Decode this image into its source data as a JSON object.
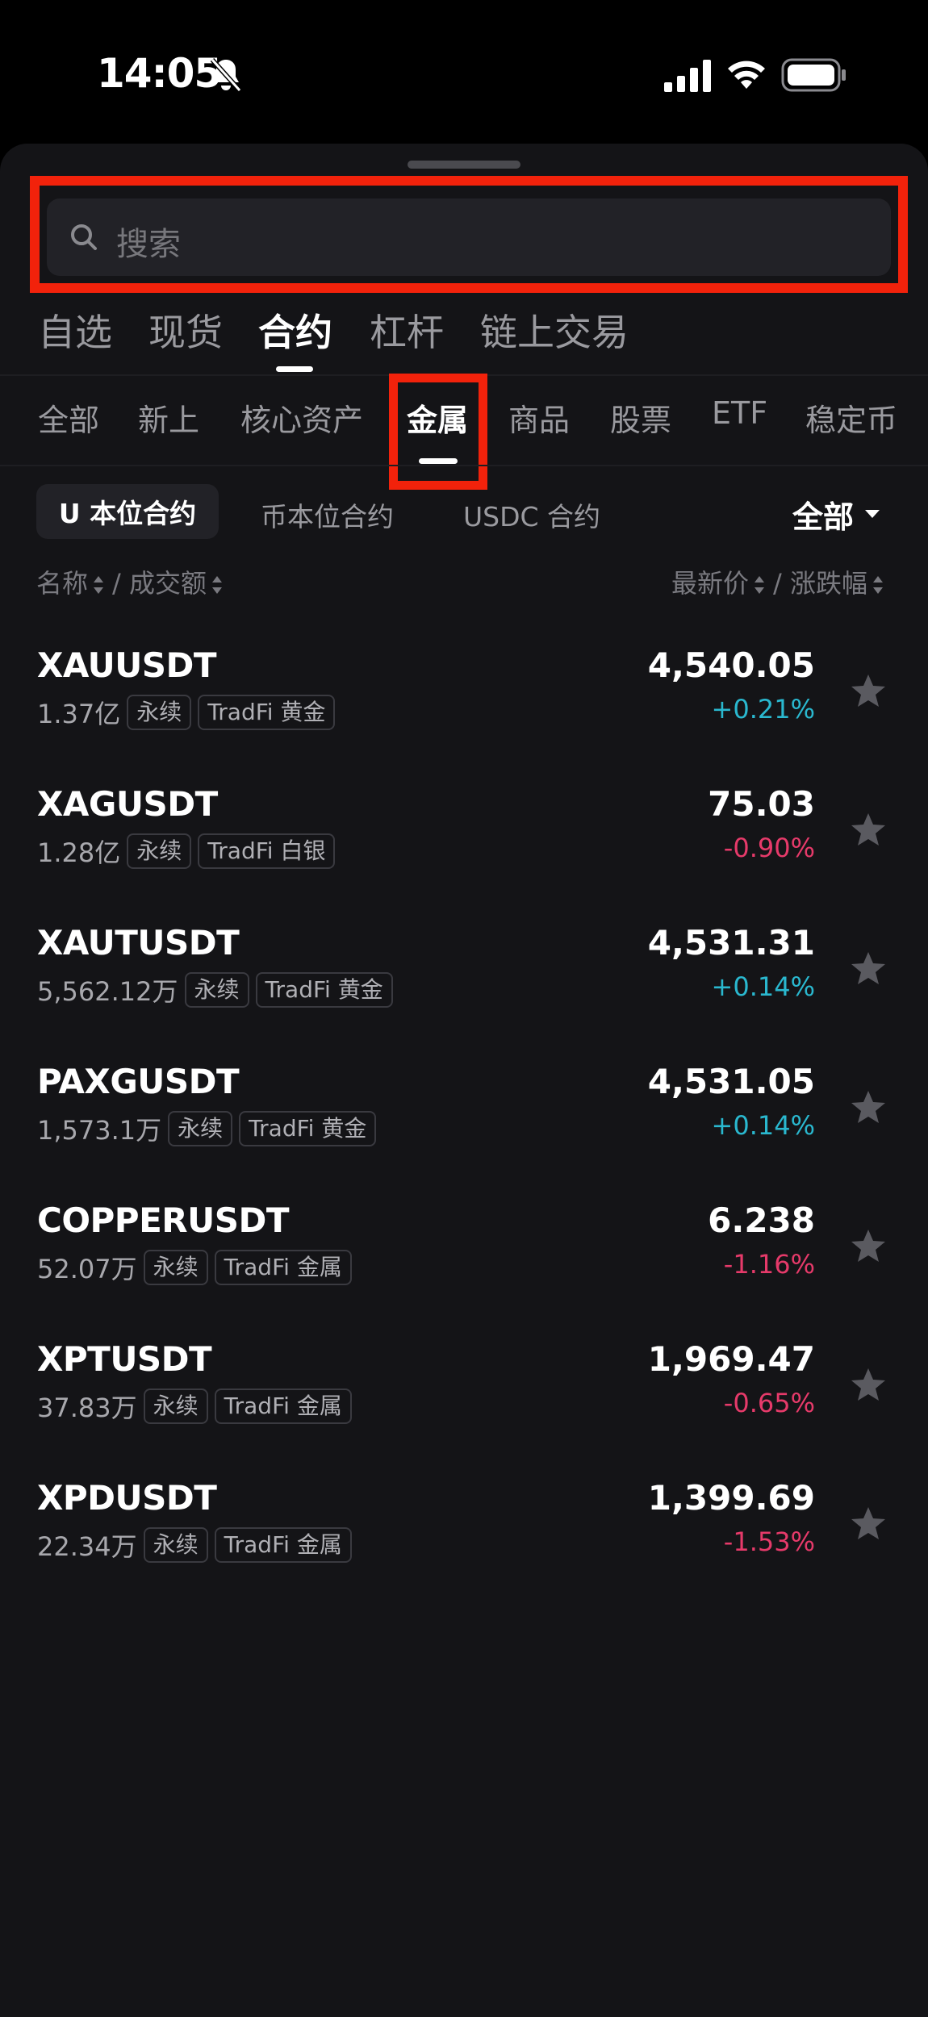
{
  "status": {
    "time": "14:05"
  },
  "search": {
    "placeholder": "搜索"
  },
  "main_tabs": [
    "自选",
    "现货",
    "合约",
    "杠杆",
    "链上交易"
  ],
  "sub_tabs": [
    "全部",
    "新上",
    "核心资产",
    "金属",
    "商品",
    "股票",
    "ETF",
    "稳定币"
  ],
  "filters": {
    "options": [
      "U 本位合约",
      "币本位合约",
      "USDC 合约"
    ],
    "all": "全部"
  },
  "headers": {
    "left_a": "名称",
    "left_b": "/ 成交额",
    "right_a": "最新价",
    "right_b": "/ 涨跌幅"
  },
  "colors": {
    "up": "#2ab8cf",
    "down": "#e63a6a",
    "highlight": "#f2220b"
  },
  "rows": [
    {
      "symbol": "XAUUSDT",
      "volume": "1.37亿",
      "tag1": "永续",
      "tag2": "TradFi 黄金",
      "price": "4,540.05",
      "change": "+0.21%",
      "dir": "up"
    },
    {
      "symbol": "XAGUSDT",
      "volume": "1.28亿",
      "tag1": "永续",
      "tag2": "TradFi 白银",
      "price": "75.03",
      "change": "-0.90%",
      "dir": "down"
    },
    {
      "symbol": "XAUTUSDT",
      "volume": "5,562.12万",
      "tag1": "永续",
      "tag2": "TradFi 黄金",
      "price": "4,531.31",
      "change": "+0.14%",
      "dir": "up"
    },
    {
      "symbol": "PAXGUSDT",
      "volume": "1,573.1万",
      "tag1": "永续",
      "tag2": "TradFi 黄金",
      "price": "4,531.05",
      "change": "+0.14%",
      "dir": "up"
    },
    {
      "symbol": "COPPERUSDT",
      "volume": "52.07万",
      "tag1": "永续",
      "tag2": "TradFi 金属",
      "price": "6.238",
      "change": "-1.16%",
      "dir": "down"
    },
    {
      "symbol": "XPTUSDT",
      "volume": "37.83万",
      "tag1": "永续",
      "tag2": "TradFi 金属",
      "price": "1,969.47",
      "change": "-0.65%",
      "dir": "down"
    },
    {
      "symbol": "XPDUSDT",
      "volume": "22.34万",
      "tag1": "永续",
      "tag2": "TradFi 金属",
      "price": "1,399.69",
      "change": "-1.53%",
      "dir": "down"
    }
  ]
}
